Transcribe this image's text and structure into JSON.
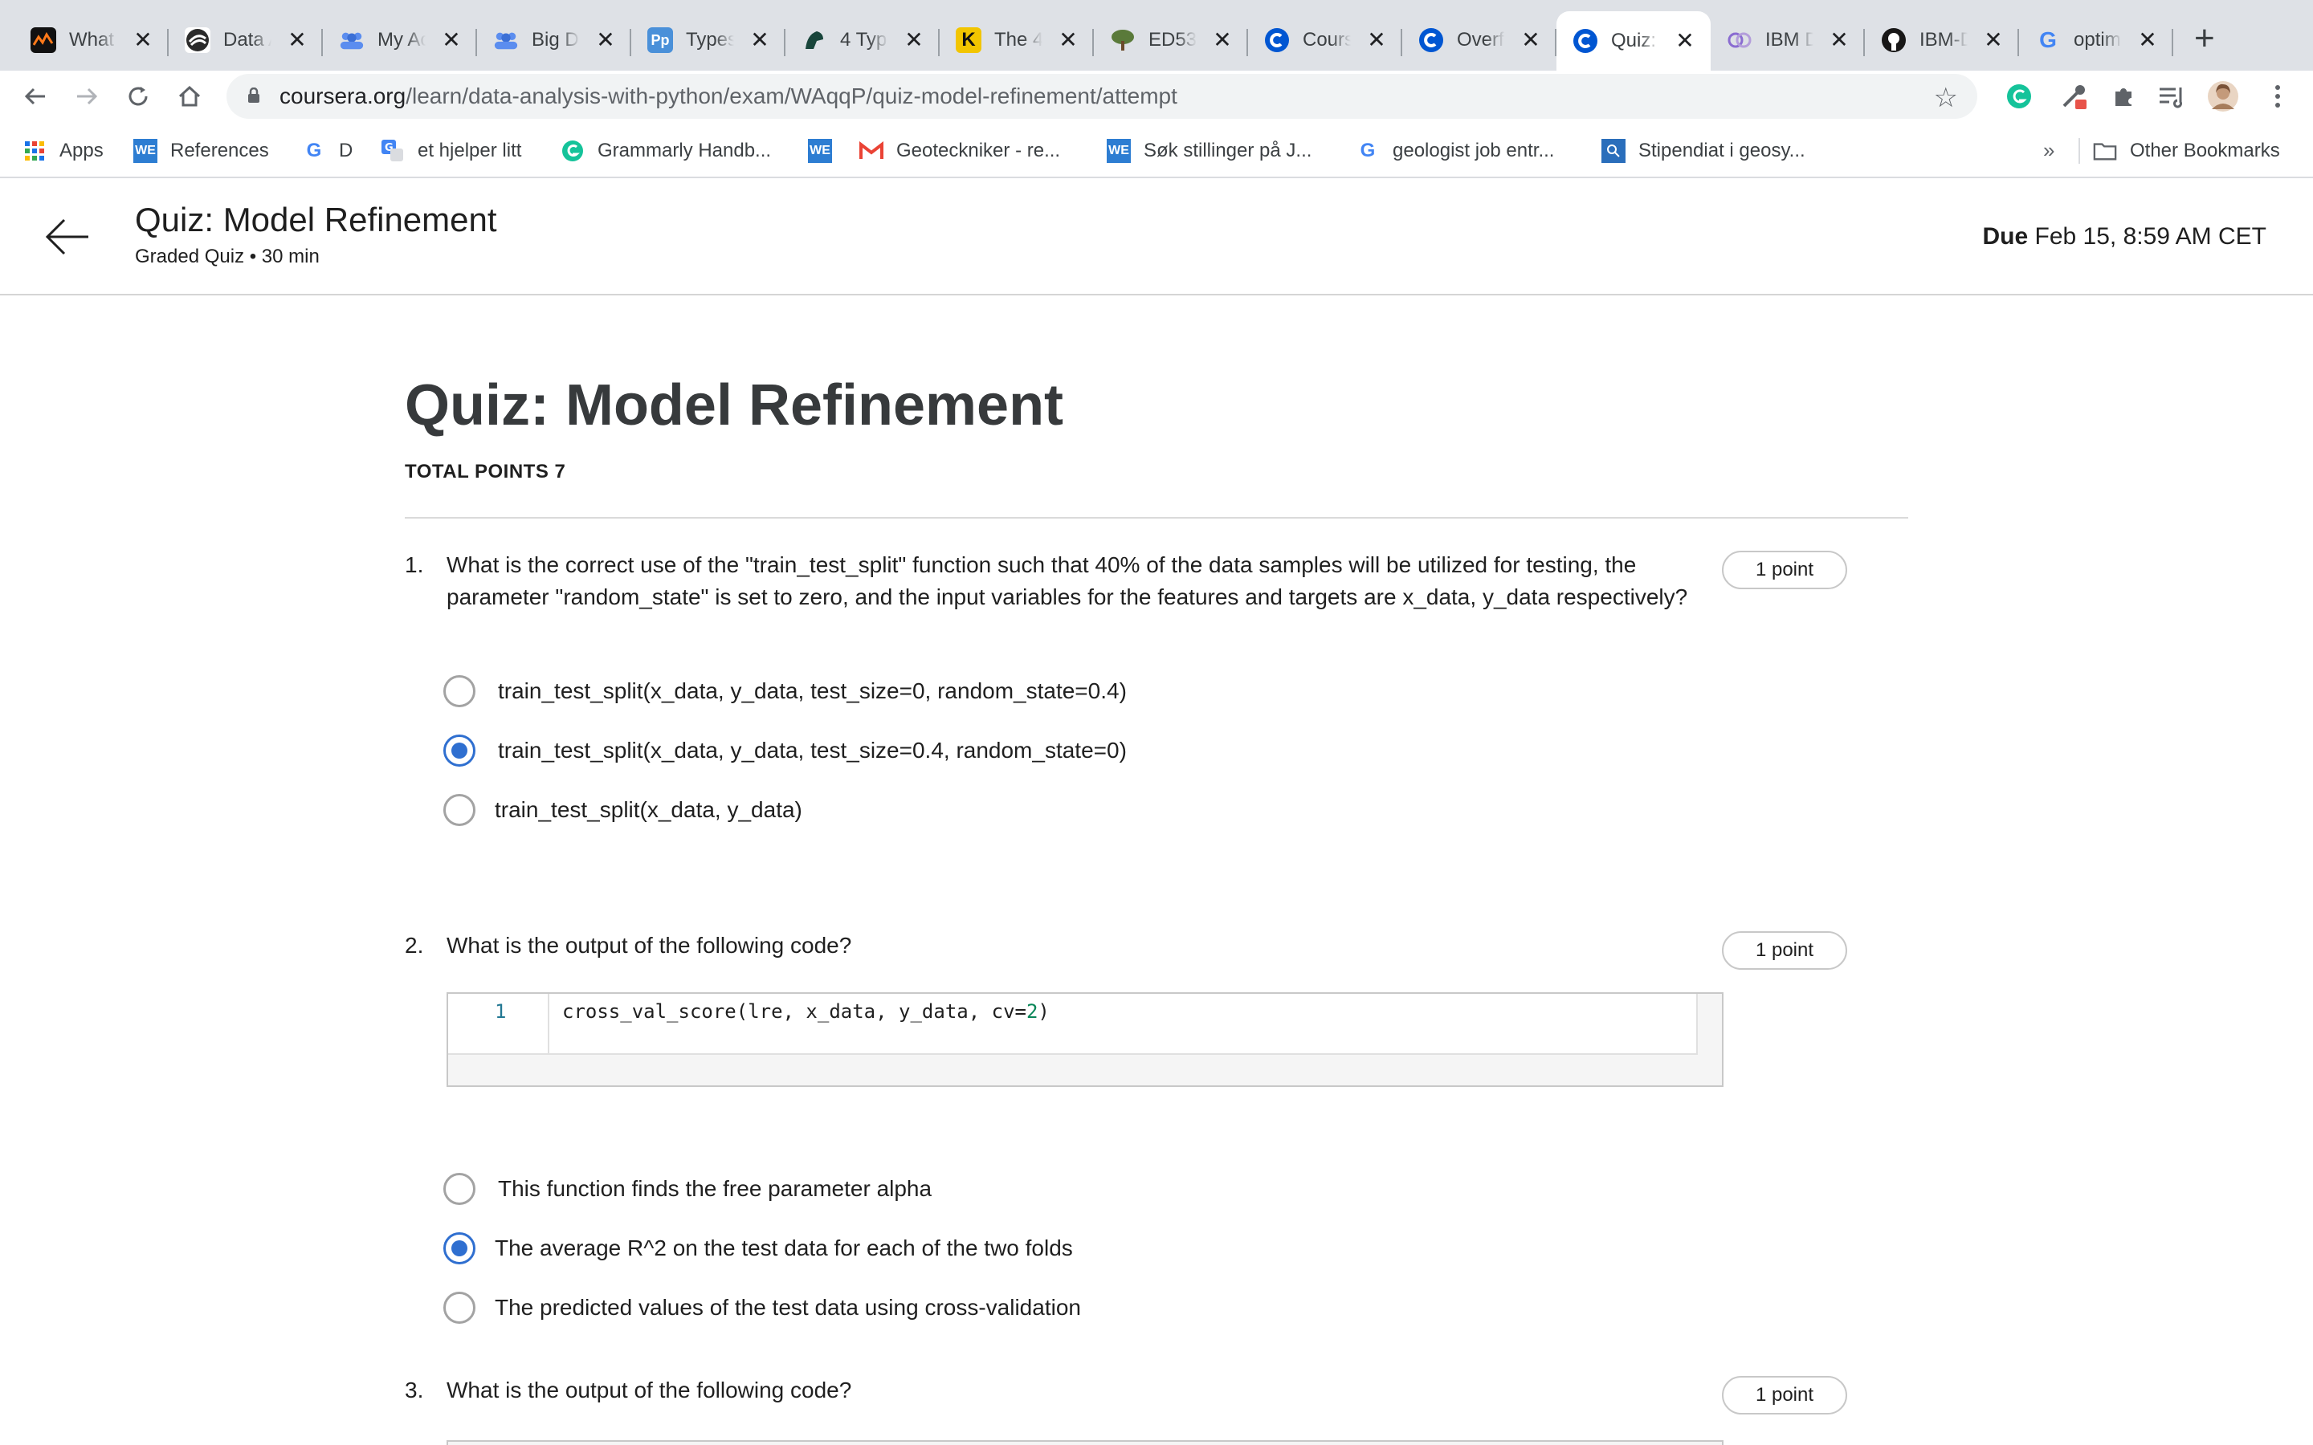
{
  "browser": {
    "tabs": [
      {
        "title": "What",
        "icon": "chart-icon",
        "color": "#111111",
        "active": false
      },
      {
        "title": "Data A",
        "icon": "swirl-icon",
        "color": "#222222",
        "active": false
      },
      {
        "title": "My Ac",
        "icon": "people-icon",
        "color": "#5b8def",
        "active": false
      },
      {
        "title": "Big Da",
        "icon": "people-icon",
        "color": "#5b8def",
        "active": false
      },
      {
        "title": "Types",
        "icon": "pp-icon",
        "color": "#4a90d9",
        "active": false
      },
      {
        "title": "4 Typ",
        "icon": "spartan-icon",
        "color": "#18453b",
        "active": false
      },
      {
        "title": "The 4",
        "icon": "k-icon",
        "color": "#f2c500",
        "active": false
      },
      {
        "title": "ED53",
        "icon": "tree-icon",
        "color": "#5a7a3a",
        "active": false
      },
      {
        "title": "Cours",
        "icon": "coursera-icon",
        "color": "#0056d2",
        "active": false
      },
      {
        "title": "Overf",
        "icon": "coursera-icon",
        "color": "#0056d2",
        "active": false
      },
      {
        "title": "Quiz:",
        "icon": "coursera-icon",
        "color": "#0056d2",
        "active": true
      },
      {
        "title": "IBM D",
        "icon": "ibm-icon",
        "color": "#8a6cd1",
        "active": false
      },
      {
        "title": "IBM-D",
        "icon": "github-icon",
        "color": "#181717",
        "active": false
      },
      {
        "title": "optim",
        "icon": "google-icon",
        "color": "#4285f4",
        "active": false
      }
    ],
    "url": {
      "host": "coursera.org",
      "path": "/learn/data-analysis-with-python/exam/WAqqP/quiz-model-refinement/attempt"
    },
    "bookmarks": [
      {
        "label": "Apps",
        "icon": "apps-grid-icon",
        "color": "#1a73e8"
      },
      {
        "label": "References",
        "icon": "we-icon",
        "color": "#2d7dd2"
      },
      {
        "label": "D",
        "icon": "google-icon",
        "color": "#4285f4"
      },
      {
        "label": "et hjelper litt",
        "icon": "translate-icon",
        "color": "#4285f4"
      },
      {
        "label": "Grammarly Handb...",
        "icon": "grammarly-icon",
        "color": "#15c39a"
      },
      {
        "label": "",
        "icon": "we-icon",
        "color": "#2d7dd2"
      },
      {
        "label": "Geoteckniker - re...",
        "icon": "gmail-icon",
        "color": "#ea4335"
      },
      {
        "label": "Søk stillinger på J...",
        "icon": "we-icon",
        "color": "#2d7dd2"
      },
      {
        "label": "geologist job entr...",
        "icon": "google-icon",
        "color": "#4285f4"
      },
      {
        "label": "Stipendiat i geosy...",
        "icon": "search-box-icon",
        "color": "#2a6ebb"
      }
    ],
    "bookmarks_more": "»",
    "other_bookmarks": "Other Bookmarks"
  },
  "header": {
    "title": "Quiz: Model Refinement",
    "subtitle": "Graded Quiz • 30 min",
    "due_label": "Due",
    "due_value": "Feb 15, 8:59 AM CET"
  },
  "quiz": {
    "title": "Quiz: Model Refinement",
    "total_points": "TOTAL POINTS 7",
    "questions": [
      {
        "number": "1.",
        "text": "What is the correct use of the \"train_test_split\" function such that 40% of the data samples will be utilized for testing, the parameter \"random_state\" is set to zero, and the input variables for the features and targets are x_data, y_data respectively?",
        "points": "1 point",
        "options": [
          {
            "label": "train_test_split(x_data, y_data, test_size=0, random_state=0.4)",
            "selected": false
          },
          {
            "label": "train_test_split(x_data, y_data, test_size=0.4, random_state=0)",
            "selected": true
          },
          {
            "label": "train_test_split(x_data, y_data)",
            "selected": false
          }
        ]
      },
      {
        "number": "2.",
        "text": "What is the output of the following code?",
        "points": "1 point",
        "code": {
          "line_number": "1",
          "code_prefix": "cross_val_score(lre, x_data, y_data, cv=",
          "code_number": "2",
          "code_suffix": ")"
        },
        "options": [
          {
            "label": "This function finds the free parameter alpha",
            "selected": false
          },
          {
            "label": "The average R^2 on the test data for each of the two folds",
            "selected": true
          },
          {
            "label": "The predicted values of the test data using cross-validation",
            "selected": false
          }
        ]
      },
      {
        "number": "3.",
        "text": "What is the output of the following code?",
        "points": "1 point"
      }
    ]
  }
}
